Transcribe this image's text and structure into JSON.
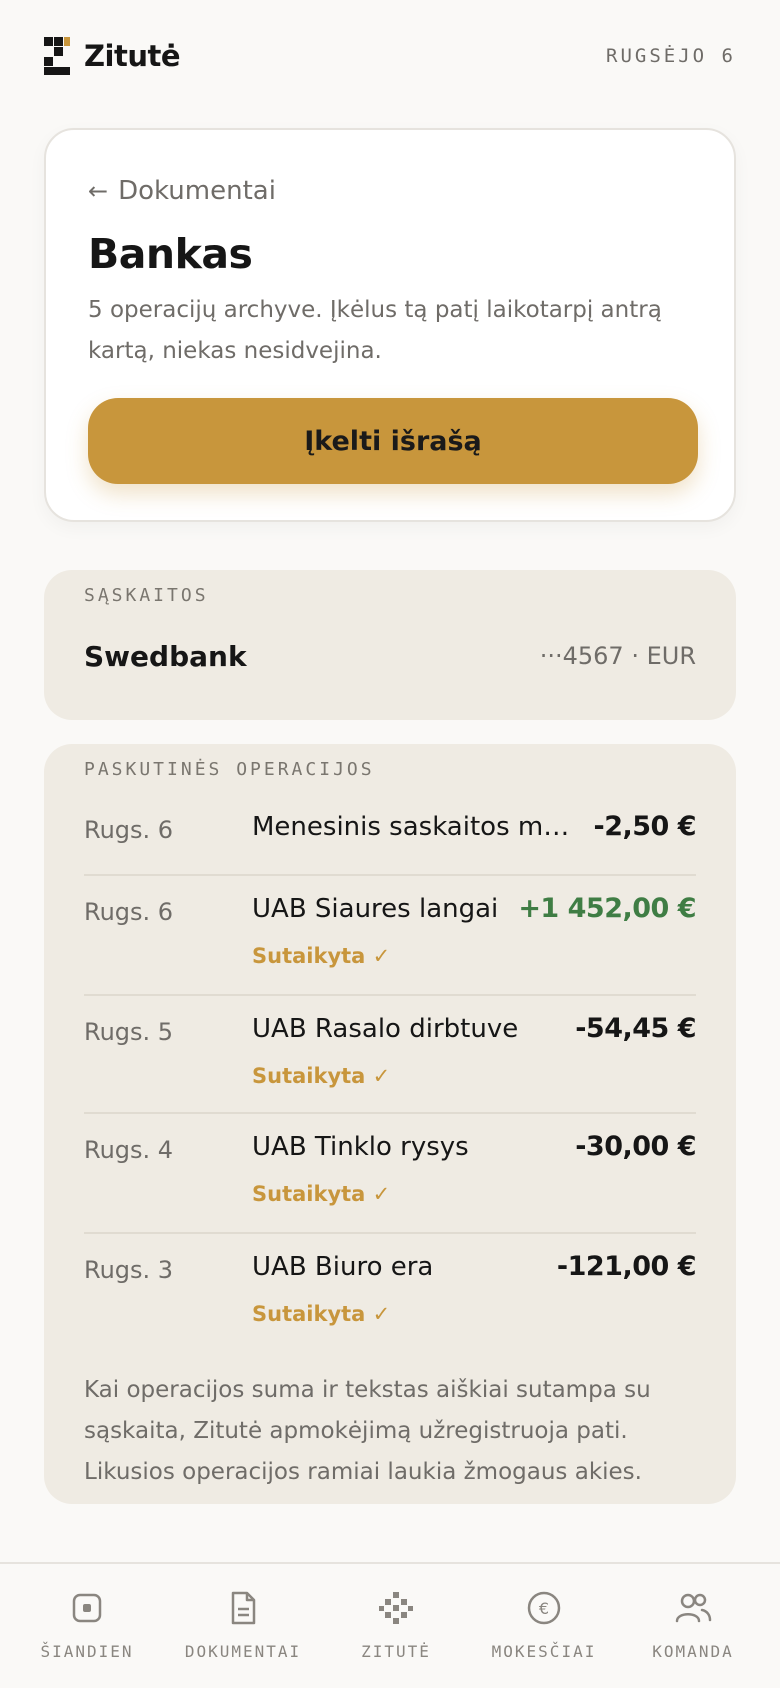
{
  "header": {
    "brand": "Zitutė",
    "date": "RUGSĖJO 6"
  },
  "hero": {
    "back_label": "Dokumentai",
    "title": "Bankas",
    "description": "5 operacijų archyve. Įkėlus tą patį laikotarpį antrą kartą, niekas nesidvejina.",
    "upload_label": "Įkelti išrašą"
  },
  "accounts": {
    "label": "SĄSKAITOS",
    "items": [
      {
        "name": "Swedbank",
        "info": "···4567 · EUR"
      }
    ]
  },
  "operations": {
    "label": "PASKUTINĖS OPERACIJOS",
    "items": [
      {
        "date": "Rugs. 6",
        "description": "Menesinis saskaitos mokestis",
        "amount": "-2,50 €",
        "status": ""
      },
      {
        "date": "Rugs. 6",
        "description": "UAB Siaures langai",
        "amount": "+1 452,00 €",
        "status": "Sutaikyta ✓"
      },
      {
        "date": "Rugs. 5",
        "description": "UAB Rasalo dirbtuve",
        "amount": "-54,45 €",
        "status": "Sutaikyta ✓"
      },
      {
        "date": "Rugs. 4",
        "description": "UAB Tinklo rysys",
        "amount": "-30,00 €",
        "status": "Sutaikyta ✓"
      },
      {
        "date": "Rugs. 3",
        "description": "UAB Biuro era",
        "amount": "-121,00 €",
        "status": "Sutaikyta ✓"
      }
    ],
    "note": "Kai operacijos suma ir tekstas aiškiai sutampa su sąskaita, Zitutė apmokėjimą užregistruoja pati. Likusios operacijos ramiai laukia žmogaus akies."
  },
  "nav": {
    "items": [
      {
        "label": "ŠIANDIEN",
        "icon": "today-icon"
      },
      {
        "label": "DOKUMENTAI",
        "icon": "document-icon"
      },
      {
        "label": "ZITUTĖ",
        "icon": "zitute-icon"
      },
      {
        "label": "MOKESČIAI",
        "icon": "euro-icon"
      },
      {
        "label": "KOMANDA",
        "icon": "team-icon"
      }
    ]
  },
  "colors": {
    "accent": "#c8963c",
    "positive": "#3f7d44",
    "panel": "#efebe3"
  }
}
